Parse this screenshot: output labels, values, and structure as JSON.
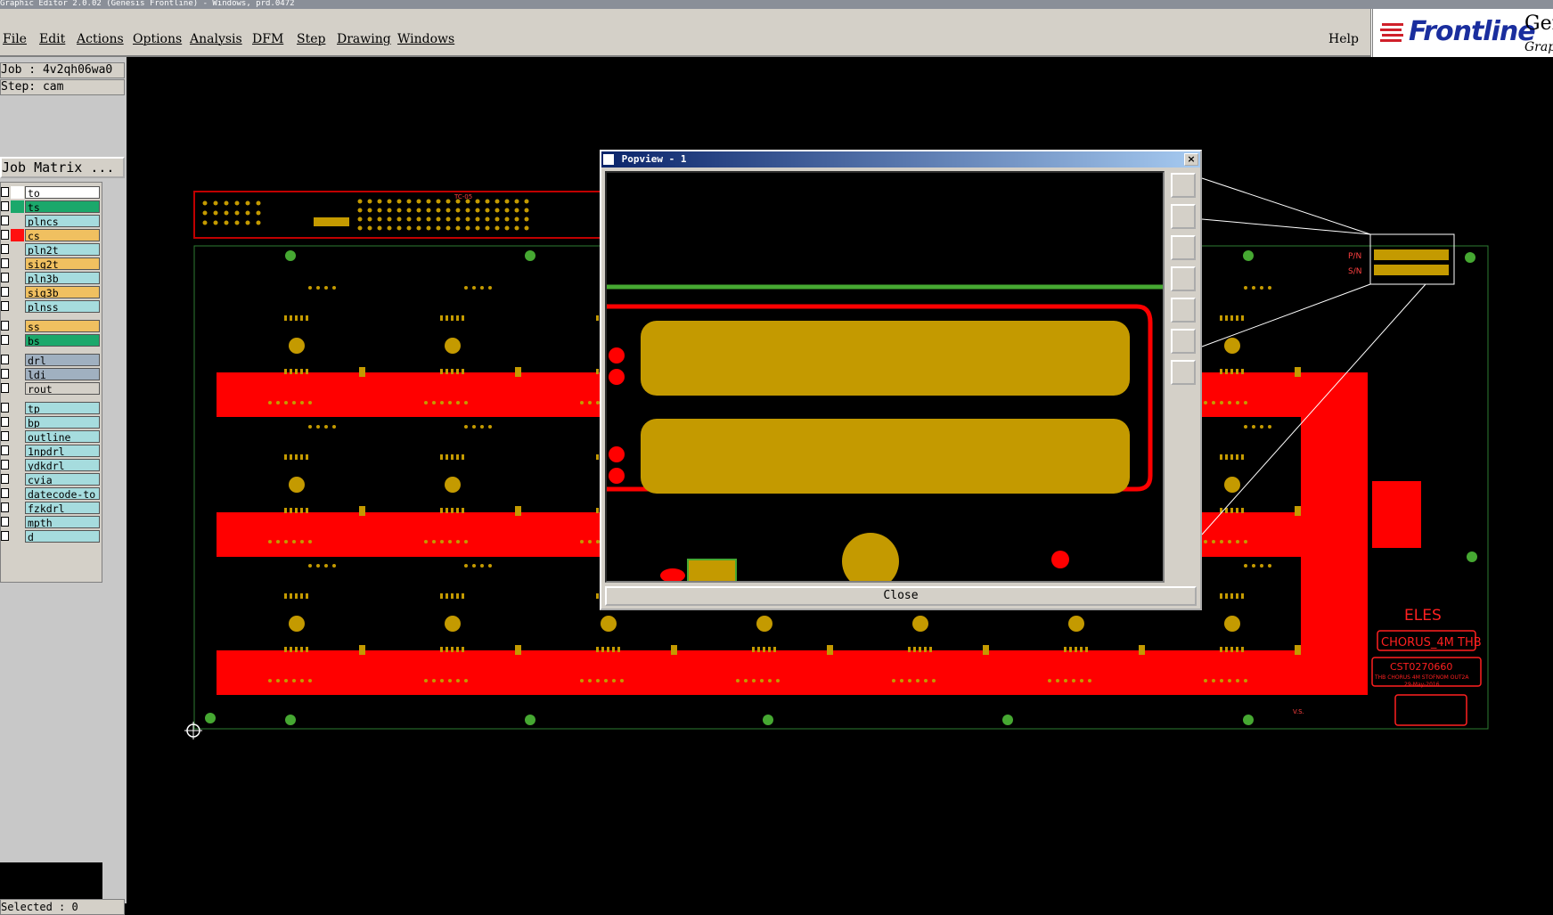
{
  "window": {
    "title": "Graphic Editor 2.0.02 (Genesis Frontline) - Windows, prd.0472"
  },
  "menu": {
    "items": [
      "File",
      "Edit",
      "Actions",
      "Options",
      "Analysis",
      "DFM",
      "Step",
      "Drawing",
      "Windows"
    ],
    "help": "Help"
  },
  "brand": {
    "logo_text": "Frontline",
    "product_top": "Gen",
    "product_bottom": "Graph"
  },
  "info": {
    "job": "Job : 4v2qh06wa0",
    "step": "Step: cam",
    "job_matrix": "Job Matrix ...",
    "selected": "Selected : 0"
  },
  "layers": [
    {
      "name": "to",
      "color": "#ffffff",
      "swatch": "#ffffff",
      "gap_before": false
    },
    {
      "name": "ts",
      "color": "#1ba86b",
      "swatch": "#1ba86b",
      "gap_before": false
    },
    {
      "name": "plncs",
      "color": "#a6dcde",
      "swatch": "#d4d0c8",
      "gap_before": false
    },
    {
      "name": "cs",
      "color": "#f0c060",
      "swatch": "#ff1010",
      "gap_before": false
    },
    {
      "name": "pln2t",
      "color": "#a6dcde",
      "swatch": "#d4d0c8",
      "gap_before": false
    },
    {
      "name": "sig2t",
      "color": "#f0c060",
      "swatch": "#d4d0c8",
      "gap_before": false
    },
    {
      "name": "pln3b",
      "color": "#a6dcde",
      "swatch": "#d4d0c8",
      "gap_before": false
    },
    {
      "name": "sig3b",
      "color": "#f0c060",
      "swatch": "#d4d0c8",
      "gap_before": false
    },
    {
      "name": "plnss",
      "color": "#a6dcde",
      "swatch": "#d4d0c8",
      "gap_before": false
    },
    {
      "name": "ss",
      "color": "#f0c060",
      "swatch": "#d4d0c8",
      "gap_before": true
    },
    {
      "name": "bs",
      "color": "#1ba86b",
      "swatch": "#d4d0c8",
      "gap_before": false
    },
    {
      "name": "drl",
      "color": "#a0b0c0",
      "swatch": "#d4d0c8",
      "gap_before": true
    },
    {
      "name": "ldi",
      "color": "#a0b0c0",
      "swatch": "#d4d0c8",
      "gap_before": false
    },
    {
      "name": "rout",
      "color": "#d4d0c8",
      "swatch": "#d4d0c8",
      "gap_before": false
    },
    {
      "name": "tp",
      "color": "#a6dcde",
      "swatch": "#d4d0c8",
      "gap_before": true
    },
    {
      "name": "bp",
      "color": "#a6dcde",
      "swatch": "#d4d0c8",
      "gap_before": false
    },
    {
      "name": "outline",
      "color": "#a6dcde",
      "swatch": "#d4d0c8",
      "gap_before": false
    },
    {
      "name": "1npdrl",
      "color": "#a6dcde",
      "swatch": "#d4d0c8",
      "gap_before": false
    },
    {
      "name": "ydkdrl",
      "color": "#a6dcde",
      "swatch": "#d4d0c8",
      "gap_before": false
    },
    {
      "name": "cvia",
      "color": "#a6dcde",
      "swatch": "#d4d0c8",
      "gap_before": false
    },
    {
      "name": "datecode-to",
      "color": "#a6dcde",
      "swatch": "#d4d0c8",
      "gap_before": false
    },
    {
      "name": "fzkdrl",
      "color": "#a6dcde",
      "swatch": "#d4d0c8",
      "gap_before": false
    },
    {
      "name": "mpth",
      "color": "#a6dcde",
      "swatch": "#d4d0c8",
      "gap_before": false
    },
    {
      "name": "d",
      "color": "#a6dcde",
      "swatch": "#d4d0c8",
      "gap_before": false
    }
  ],
  "popup": {
    "title": "Popview - 1",
    "close_label": "Close",
    "close_x": "×"
  },
  "board": {
    "pn_label": "P/N",
    "sn_label": "S/N",
    "eles": "ELES",
    "model": "CHORUS_4M THB",
    "code": "CST0270660",
    "subline": "THB CHORUS 4M STOFNOM OUT2A",
    "date": "29-May-2016",
    "vs": "V.S.",
    "tc": "TC-05"
  },
  "colors": {
    "copper_red": "#ff0000",
    "pad_gold": "#c49a00",
    "via_green": "#46a832",
    "outline_green": "#2e7d32"
  }
}
